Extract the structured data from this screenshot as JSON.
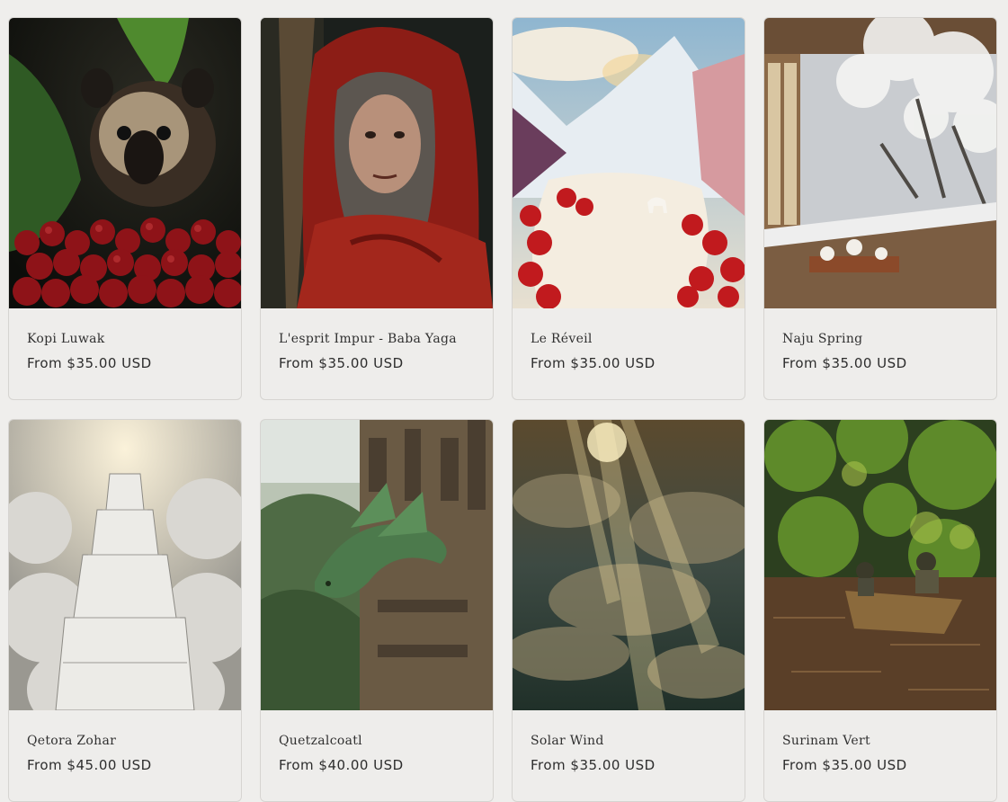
{
  "products": [
    {
      "title": "Kopi Luwak",
      "price": "From $35.00 USD",
      "image": "civet-with-coffee-cherries"
    },
    {
      "title": "L'esprit Impur - Baba Yaga",
      "price": "From $35.00 USD",
      "image": "old-woman-red-hood-broom"
    },
    {
      "title": "Le Réveil",
      "price": "From $35.00 USD",
      "image": "mountain-cream-strawberries-goat"
    },
    {
      "title": "Naju Spring",
      "price": "From $35.00 USD",
      "image": "snowy-veranda-tea-table"
    },
    {
      "title": "Qetora Zohar",
      "price": "From $45.00 USD",
      "image": "white-tower-in-clouds"
    },
    {
      "title": "Quetzalcoatl",
      "price": "From $40.00 USD",
      "image": "dragon-on-jungle-temple"
    },
    {
      "title": "Solar Wind",
      "price": "From $35.00 USD",
      "image": "sunrays-through-clouds"
    },
    {
      "title": "Surinam Vert",
      "price": "From $35.00 USD",
      "image": "canoe-on-jungle-river"
    }
  ]
}
